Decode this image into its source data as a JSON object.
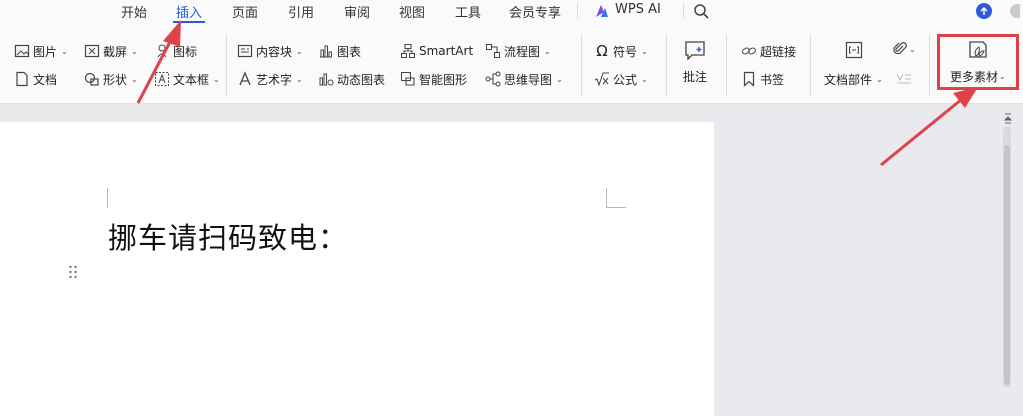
{
  "tabs": [
    {
      "label": "开始"
    },
    {
      "label": "插入"
    },
    {
      "label": "页面"
    },
    {
      "label": "引用"
    },
    {
      "label": "审阅"
    },
    {
      "label": "视图"
    },
    {
      "label": "工具"
    },
    {
      "label": "会员专享"
    },
    {
      "label": "WPS AI"
    }
  ],
  "active_tab": "插入",
  "ribbon": {
    "picture": "图片",
    "screenshot": "截屏",
    "icons": "图标",
    "content_block": "内容块",
    "chart": "图表",
    "smartart": "SmartArt",
    "flowchart": "流程图",
    "document": "文档",
    "shape": "形状",
    "textbox": "文本框",
    "wordart": "艺术字",
    "dynamic_chart": "动态图表",
    "smart_graphic": "智能图形",
    "mindmap": "思维导图",
    "symbol": "符号",
    "formula": "公式",
    "comment": "批注",
    "hyperlink": "超链接",
    "bookmark": "书签",
    "doc_parts": "文档部件",
    "more_materials": "更多素材"
  },
  "document": {
    "text": "挪车请扫码致电："
  },
  "colors": {
    "accent": "#2b5cd6",
    "highlight": "#e0424a"
  }
}
